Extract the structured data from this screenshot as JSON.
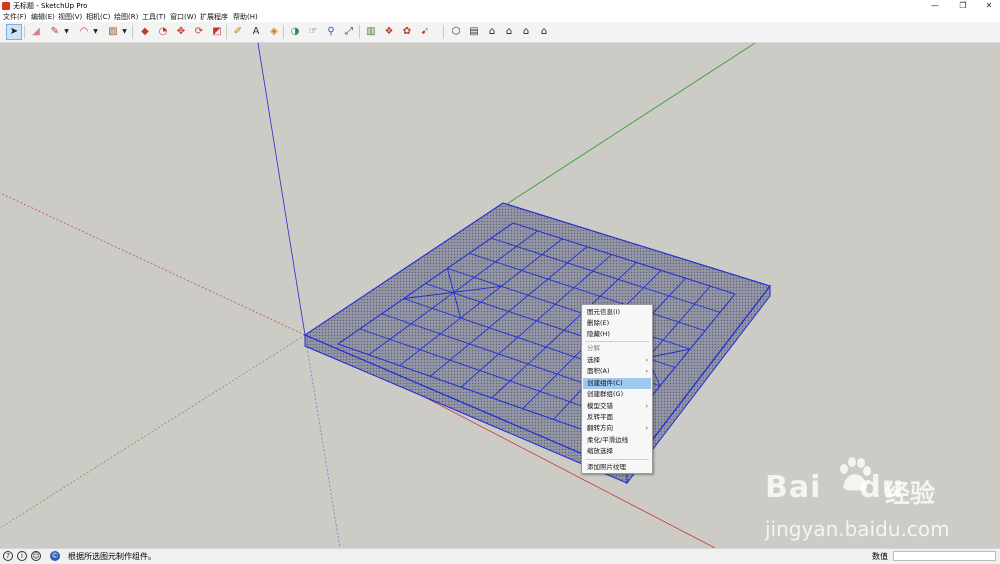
{
  "window": {
    "title": "无标题 - SketchUp Pro",
    "controls": [
      "—",
      "❐",
      "✕"
    ]
  },
  "menus": [
    "文件(F)",
    "编辑(E)",
    "视图(V)",
    "相机(C)",
    "绘图(R)",
    "工具(T)",
    "窗口(W)",
    "扩展程序",
    "帮助(H)"
  ],
  "toolbar": {
    "tools": [
      {
        "icon": "select-arrow-icon",
        "glyph": "➤",
        "color": "#1a1a1a"
      },
      {
        "icon": "eraser-icon",
        "glyph": "◢",
        "color": "#e07a8a"
      },
      {
        "icon": "pencil-icon",
        "glyph": "✎",
        "color": "#c0392b"
      },
      {
        "icon": "arc-icon",
        "glyph": "◠",
        "color": "#c0392b"
      },
      {
        "icon": "rectangle-icon",
        "glyph": "▨",
        "color": "#8a5a3a"
      },
      {
        "icon": "push-pull-icon",
        "glyph": "◆",
        "color": "#c0392b"
      },
      {
        "icon": "follow-me-icon",
        "glyph": "◔",
        "color": "#c0392b"
      },
      {
        "icon": "move-icon",
        "glyph": "✥",
        "color": "#c0392b"
      },
      {
        "icon": "rotate-icon",
        "glyph": "⟳",
        "color": "#c0392b"
      },
      {
        "icon": "scale-icon",
        "glyph": "◩",
        "color": "#c0392b"
      },
      {
        "icon": "tape-measure-icon",
        "glyph": "✐",
        "color": "#b8860b"
      },
      {
        "icon": "text-icon",
        "glyph": "A",
        "color": "#333333"
      },
      {
        "icon": "paint-bucket-icon",
        "glyph": "◈",
        "color": "#b8860b"
      },
      {
        "icon": "orbit-icon",
        "glyph": "◑",
        "color": "#2e8b57"
      },
      {
        "icon": "pan-icon",
        "glyph": "☞",
        "color": "#444444"
      },
      {
        "icon": "zoom-icon",
        "glyph": "⚲",
        "color": "#2a5db0"
      },
      {
        "icon": "zoom-extents-icon",
        "glyph": "⤢",
        "color": "#333333"
      },
      {
        "icon": "warehouse-icon",
        "glyph": "▥",
        "color": "#4a7a3a"
      },
      {
        "icon": "extension-icon",
        "glyph": "❖",
        "color": "#c0392b"
      },
      {
        "icon": "share-model-icon",
        "glyph": "✿",
        "color": "#c0392b"
      },
      {
        "icon": "layout-icon",
        "glyph": "➹",
        "color": "#c0392b"
      },
      {
        "icon": "iso-view-icon",
        "glyph": "⬡",
        "color": "#333333"
      },
      {
        "icon": "top-view-icon",
        "glyph": "▤",
        "color": "#333333"
      },
      {
        "icon": "front-view-icon",
        "glyph": "⌂",
        "color": "#222222"
      },
      {
        "icon": "right-view-icon",
        "glyph": "⌂",
        "color": "#222222"
      },
      {
        "icon": "back-view-icon",
        "glyph": "⌂",
        "color": "#222222"
      },
      {
        "icon": "left-view-icon",
        "glyph": "⌂",
        "color": "#222222"
      }
    ]
  },
  "context_menu": {
    "items": [
      {
        "label": "图元信息(I)"
      },
      {
        "label": "删除(E)"
      },
      {
        "label": "隐藏(H)"
      },
      {
        "label": "分解",
        "disabled": true
      },
      {
        "label": "选择",
        "submenu": true
      },
      {
        "label": "面积(A)",
        "submenu": true
      },
      {
        "label": "创建组件(C)",
        "highlighted": true
      },
      {
        "label": "创建群组(G)"
      },
      {
        "label": "模型交错",
        "submenu": true
      },
      {
        "label": "反转平面"
      },
      {
        "label": "翻转方向",
        "submenu": true
      },
      {
        "label": "柔化/平滑边线"
      },
      {
        "label": "缩放选择"
      },
      {
        "label": "添加照片纹理"
      }
    ]
  },
  "statusbar": {
    "message": "根据所选图元制作组件。",
    "measurement_label": "数值",
    "measurement_value": ""
  },
  "watermark": {
    "logo_left": "Bai",
    "logo_right": "du",
    "cn": "经验",
    "url": "jingyan.baidu.com"
  },
  "colors": {
    "selection": "#1f2fd6",
    "viewport_bg": "#cdcbc5",
    "board_face": "#8c8e9b"
  }
}
